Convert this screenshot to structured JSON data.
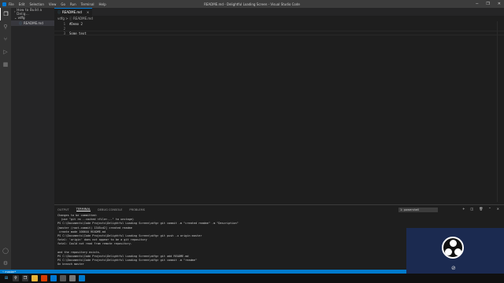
{
  "window": {
    "title": "README.md - Delightful Loading Screen - Visual Studio Code",
    "menu": [
      "File",
      "Edit",
      "Selection",
      "View",
      "Go",
      "Run",
      "Terminal",
      "Help"
    ]
  },
  "activity_bar": {
    "items": [
      "files-icon",
      "search-icon",
      "source-control-icon",
      "run-debug-icon",
      "extensions-icon"
    ],
    "bottom": [
      "account-icon",
      "settings-gear-icon"
    ]
  },
  "sidebar": {
    "header": "How to Build a Delig...",
    "folder": "vdfg",
    "file": "README.md"
  },
  "editor": {
    "tab_label": "README.md",
    "breadcrumb": "vdfg > ⓘ README.md",
    "lines": [
      {
        "num": "1",
        "text": "#Demo 2"
      },
      {
        "num": "2",
        "text": ""
      },
      {
        "num": "3",
        "text": "Some text"
      }
    ]
  },
  "panel": {
    "tabs": [
      "OUTPUT",
      "TERMINAL",
      "DEBUG CONSOLE",
      "PROBLEMS"
    ],
    "active_tab": "TERMINAL",
    "terminal_select": "1: powershell",
    "terminal_lines": [
      "Changes to be committed:",
      "  (use \"git rm --cached <file>...\" to unstage)",
      "PS C:\\Documents\\Code Projects\\Delightful Loading Screen\\vdfg> git commit -m \"created readme\" -m \"Description\"",
      "[master (root-commit) 1345cd2] created readme",
      " create mode 100644 README.md",
      "PS C:\\Documents\\Code Projects\\Delightful Loading Screen\\vdfg> git push -u origin master",
      "fatal: 'origin' does not appear to be a git repository",
      "fatal: Could not read from remote repository.",
      "",
      "and the repository exists.",
      "PS C:\\Documents\\Code Projects\\Delightful Loading Screen\\vdfg> git add README.md",
      "PS C:\\Documents\\Code Projects\\Delightful Loading Screen\\vdfg> git commit -m \"readme\"",
      "On branch master"
    ]
  },
  "status_bar": {
    "branch": "master*"
  },
  "colors": {
    "accent": "#007acc",
    "titlebar": "#3c3c3c",
    "sidebar": "#252526",
    "editor": "#1e1e1e"
  }
}
